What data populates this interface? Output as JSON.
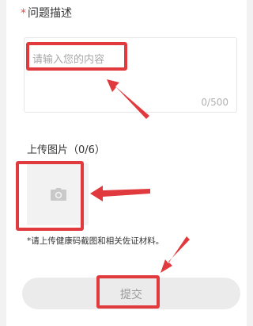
{
  "form": {
    "description_label": "问题描述",
    "required_mark": "*",
    "description_placeholder": "请输入您的内容",
    "char_counter": "0/500",
    "upload_label": "上传图片（0/6）",
    "upload_note": "*请上传健康码截图和相关佐证材料。",
    "submit_label": "提交"
  },
  "icons": {
    "upload": "camera-icon",
    "annotation": "arrow-icon"
  },
  "colors": {
    "required_star": "#e84d4d",
    "highlight": "#e0393e",
    "button_bg": "#ebebeb",
    "button_text": "#9a9a9a"
  }
}
